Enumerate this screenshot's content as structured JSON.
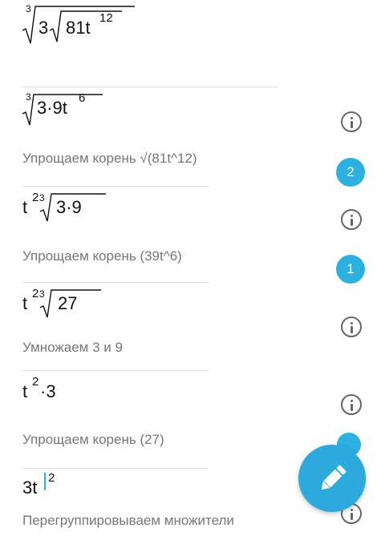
{
  "steps": [
    {
      "label": "Упрощаем корень √(81t^12)",
      "badge": "2"
    },
    {
      "label": "Упрощаем корень (39t^6)",
      "badge": "1"
    },
    {
      "label": "Умножаем 3 и 9"
    },
    {
      "label": "Упрощаем корень (27)",
      "badge": ""
    },
    {
      "label": "Перегруппировываем множители"
    }
  ],
  "expr0": {
    "index": "3",
    "coef": "3",
    "radicand": "81t",
    "exp": "12"
  },
  "expr1": {
    "index": "3",
    "radicand": "3·9t",
    "exp": "6"
  },
  "expr2": {
    "base": "t",
    "exp": "2",
    "index": "3",
    "radicand": "3·9"
  },
  "expr3": {
    "base": "t",
    "exp": "2",
    "index": "3",
    "radicand": "27"
  },
  "expr4": {
    "base": "t",
    "exp": "2",
    "tail": "·3"
  },
  "expr5": {
    "coef": "3t",
    "exp": "2"
  },
  "colors": {
    "accent": "#2db0e0",
    "icon": "#666666",
    "muted": "#777777"
  },
  "icons": {
    "info": "info-icon",
    "edit": "pencil-icon"
  }
}
